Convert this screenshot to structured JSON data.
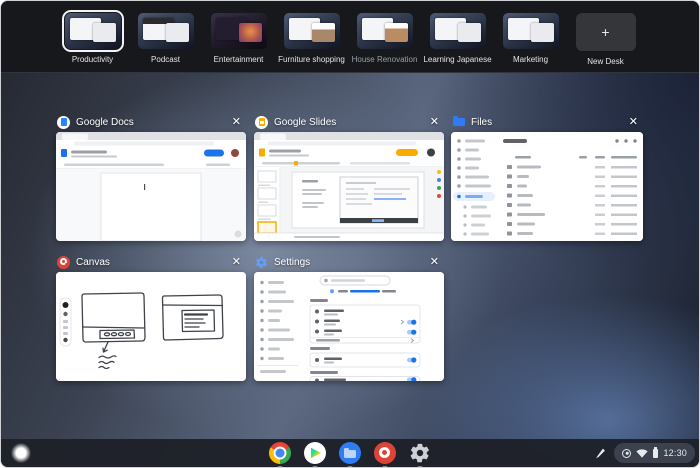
{
  "glyphs": {
    "close": "✕",
    "plus": "+"
  },
  "desks": {
    "items": [
      {
        "label": "Productivity",
        "selected": true
      },
      {
        "label": "Podcast",
        "selected": false
      },
      {
        "label": "Entertainment",
        "selected": false
      },
      {
        "label": "Furniture shopping",
        "selected": false
      },
      {
        "label": "House Renovation",
        "selected": false
      },
      {
        "label": "Learning Japanese",
        "selected": false
      },
      {
        "label": "Marketing",
        "selected": false
      }
    ],
    "new_desk_label": "New Desk"
  },
  "windows": [
    {
      "title": "Google Docs",
      "icon": "google-docs-icon"
    },
    {
      "title": "Google Slides",
      "icon": "google-slides-icon"
    },
    {
      "title": "Files",
      "icon": "files-icon"
    },
    {
      "title": "Canvas",
      "icon": "canvas-icon"
    },
    {
      "title": "Settings",
      "icon": "settings-icon"
    }
  ],
  "shelf": {
    "apps": [
      "chrome",
      "play-store",
      "files",
      "canvas",
      "settings"
    ],
    "tray": {
      "time": "12:30",
      "icons": [
        "stylus",
        "status",
        "wifi",
        "battery"
      ]
    }
  },
  "colors": {
    "accent_blue": "#1a73e8",
    "slides_yellow": "#f9ab00",
    "canvas_red": "#dd4437",
    "selected_desk_border": "#ffffff",
    "desks_bar_bg": "#17181c",
    "shelf_bg": "#1e2128",
    "toggle_on": "#1a73e8"
  }
}
